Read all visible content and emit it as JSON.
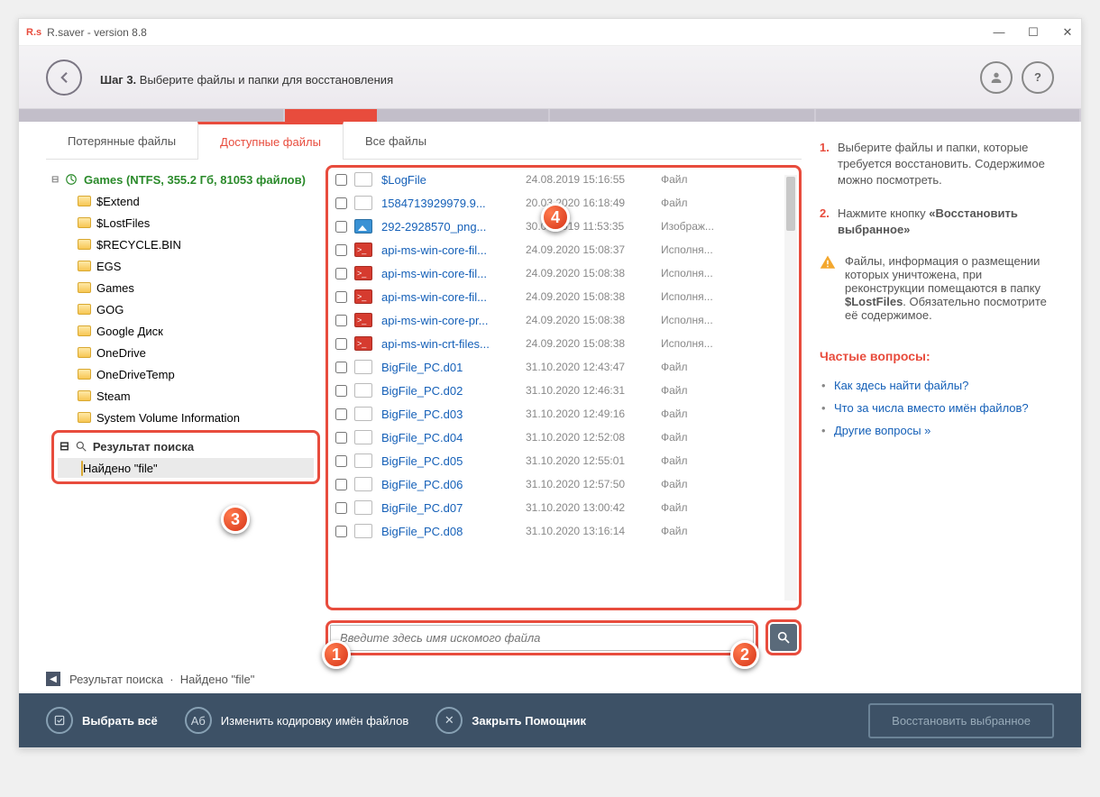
{
  "window": {
    "app_logo": "R.s",
    "title": "R.saver - version 8.8"
  },
  "header": {
    "step_prefix": "Шаг 3.",
    "step_text": " Выберите файлы и папки для восстановления"
  },
  "tabs": {
    "lost": "Потерянные файлы",
    "available": "Доступные файлы",
    "all": "Все файлы"
  },
  "tree": {
    "root": "Games (NTFS, 355.2 Гб, 81053 файлов)",
    "folders": [
      "$Extend",
      "$LostFiles",
      "$RECYCLE.BIN",
      "EGS",
      "Games",
      "GOG",
      "Google Диск",
      "OneDrive",
      "OneDriveTemp",
      "Steam",
      "System Volume Information"
    ],
    "search_label": "Результат поиска",
    "found_label": "Найдено \"file\""
  },
  "files": [
    {
      "name": "$LogFile",
      "date": "24.08.2019 15:16:55",
      "type": "Файл",
      "icon": "doc"
    },
    {
      "name": "1584713929979.9...",
      "date": "20.03.2020 16:18:49",
      "type": "Файл",
      "icon": "doc"
    },
    {
      "name": "292-2928570_png...",
      "date": "30.07.2019 11:53:35",
      "type": "Изображ...",
      "icon": "img"
    },
    {
      "name": "api-ms-win-core-fil...",
      "date": "24.09.2020 15:08:37",
      "type": "Исполня...",
      "icon": "exe"
    },
    {
      "name": "api-ms-win-core-fil...",
      "date": "24.09.2020 15:08:38",
      "type": "Исполня...",
      "icon": "exe"
    },
    {
      "name": "api-ms-win-core-fil...",
      "date": "24.09.2020 15:08:38",
      "type": "Исполня...",
      "icon": "exe"
    },
    {
      "name": "api-ms-win-core-pr...",
      "date": "24.09.2020 15:08:38",
      "type": "Исполня...",
      "icon": "exe"
    },
    {
      "name": "api-ms-win-crt-files...",
      "date": "24.09.2020 15:08:38",
      "type": "Исполня...",
      "icon": "exe"
    },
    {
      "name": "BigFile_PC.d01",
      "date": "31.10.2020 12:43:47",
      "type": "Файл",
      "icon": "doc"
    },
    {
      "name": "BigFile_PC.d02",
      "date": "31.10.2020 12:46:31",
      "type": "Файл",
      "icon": "doc"
    },
    {
      "name": "BigFile_PC.d03",
      "date": "31.10.2020 12:49:16",
      "type": "Файл",
      "icon": "doc"
    },
    {
      "name": "BigFile_PC.d04",
      "date": "31.10.2020 12:52:08",
      "type": "Файл",
      "icon": "doc"
    },
    {
      "name": "BigFile_PC.d05",
      "date": "31.10.2020 12:55:01",
      "type": "Файл",
      "icon": "doc"
    },
    {
      "name": "BigFile_PC.d06",
      "date": "31.10.2020 12:57:50",
      "type": "Файл",
      "icon": "doc"
    },
    {
      "name": "BigFile_PC.d07",
      "date": "31.10.2020 13:00:42",
      "type": "Файл",
      "icon": "doc"
    },
    {
      "name": "BigFile_PC.d08",
      "date": "31.10.2020 13:16:14",
      "type": "Файл",
      "icon": "doc"
    }
  ],
  "search": {
    "placeholder": "Введите здесь имя искомого файла"
  },
  "breadcrumb": {
    "part1": "Результат поиска",
    "sep": "·",
    "part2": "Найдено \"file\""
  },
  "sidebar": {
    "step1": "Выберите файлы и папки, которые требуется восстановить. Содержимое можно посмотреть.",
    "step2_a": "Нажмите кнопку ",
    "step2_b": "«Восстановить выбранное»",
    "warn_a": "Файлы, информация о размещении которых уничтожена, при реконструкции помещаются в папку ",
    "warn_b": "$LostFiles",
    "warn_c": ". Обязательно посмотрите её содержимое.",
    "faq_title": "Частые вопросы:",
    "faq": [
      "Как здесь найти файлы?",
      "Что за числа вместо имён файлов?",
      "Другие вопросы »"
    ]
  },
  "footer": {
    "select_all": "Выбрать всё",
    "encoding": "Изменить кодировку имён файлов",
    "encoding_icon": "Aб",
    "close": "Закрыть Помощник",
    "restore": "Восстановить выбранное"
  },
  "callouts": {
    "c1": "1",
    "c2": "2",
    "c3": "3",
    "c4": "4"
  }
}
